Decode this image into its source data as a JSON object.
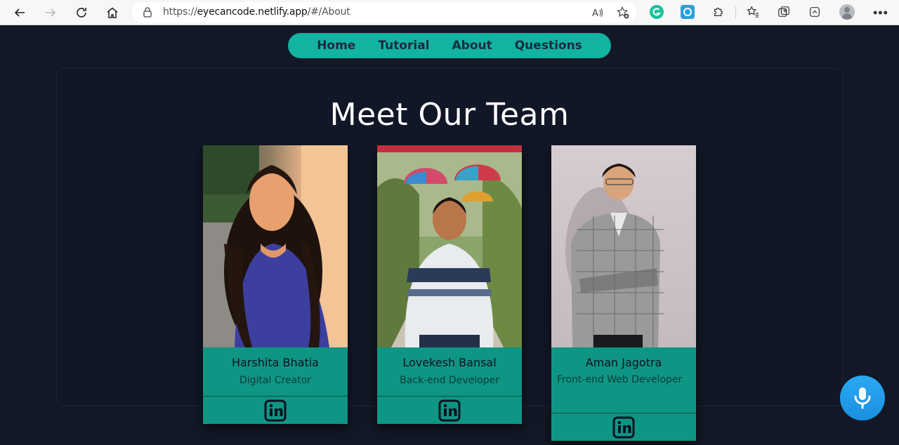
{
  "browser": {
    "url_prefix": "https://",
    "url_host": "eyecancode.netlify.app",
    "url_path": "/#/About"
  },
  "nav": {
    "items": [
      "Home",
      "Tutorial",
      "About",
      "Questions"
    ]
  },
  "page": {
    "title": "Meet Our Team"
  },
  "team": [
    {
      "name": "Harshita Bhatia",
      "role": "Digital Creator"
    },
    {
      "name": "Lovekesh Bansal",
      "role": "Back-end Developer"
    },
    {
      "name": "Aman Jagotra",
      "role": "Front-end Web Developer"
    }
  ],
  "colors": {
    "background": "#121826",
    "accent": "#12b3a0",
    "card": "#0e9584",
    "mic": "#1b8fe0"
  },
  "icons": {
    "social": "linkedin-icon",
    "voice": "microphone-icon"
  }
}
